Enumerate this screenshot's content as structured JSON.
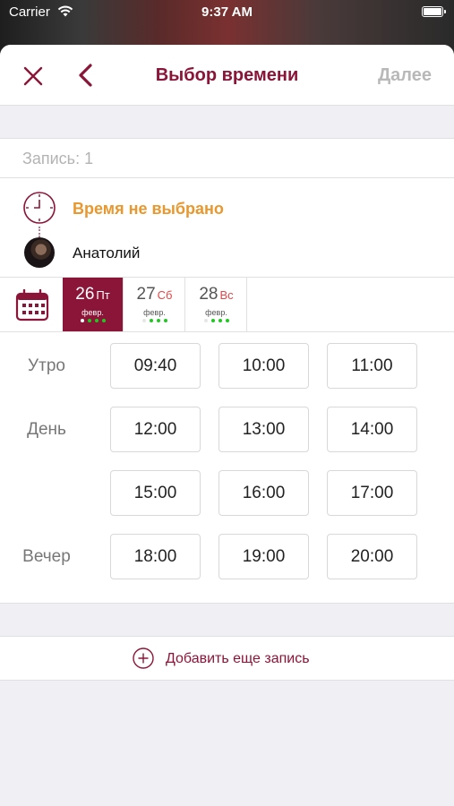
{
  "status_bar": {
    "carrier": "Carrier",
    "time": "9:37 AM"
  },
  "nav": {
    "title": "Выбор времени",
    "next_label": "Далее"
  },
  "record": {
    "label": "Запись: 1"
  },
  "selection": {
    "time_status": "Время не выбрано",
    "master_name": "Анатолий"
  },
  "dates": [
    {
      "num": "26",
      "weekday": "Пт",
      "month": "февр.",
      "selected": true
    },
    {
      "num": "27",
      "weekday": "Сб",
      "month": "февр.",
      "selected": false
    },
    {
      "num": "28",
      "weekday": "Вс",
      "month": "февр.",
      "selected": false
    }
  ],
  "periods": {
    "morning": "Утро",
    "day": "День",
    "evening": "Вечер"
  },
  "slots": {
    "morning": [
      "09:40",
      "10:00",
      "11:00"
    ],
    "day_row1": [
      "12:00",
      "13:00",
      "14:00"
    ],
    "day_row2": [
      "15:00",
      "16:00",
      "17:00"
    ],
    "evening": [
      "18:00",
      "19:00",
      "20:00"
    ]
  },
  "add_record": {
    "label": "Добавить еще запись"
  },
  "colors": {
    "accent": "#8b1538",
    "warning": "#e8982e",
    "available_dot": "#22c822"
  }
}
